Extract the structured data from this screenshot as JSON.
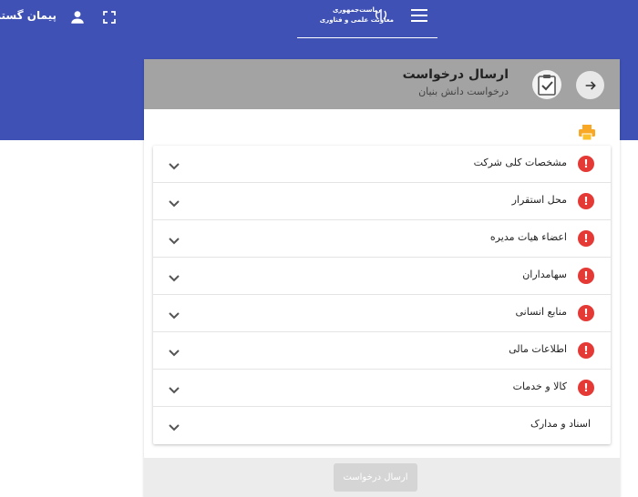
{
  "header": {
    "user_name": "پیمان گستران د",
    "brand_line1": "ریاست‌جمهوری",
    "brand_line2": "معاونت علمی و فناوری",
    "icons": {
      "user": "user-icon",
      "fullscreen": "fullscreen-icon",
      "menu": "menu-icon",
      "emblem": "iran-emblem-icon"
    }
  },
  "card": {
    "title": "ارسال درخواست",
    "subtitle": "درخواست دانش بنیان",
    "print_icon": "printer-icon",
    "print_color": "#f9a825"
  },
  "sections": [
    {
      "label": "مشخصات کلی شرکت",
      "alert": true
    },
    {
      "label": "محل استقرار",
      "alert": true
    },
    {
      "label": "اعضاء هیات مدیره",
      "alert": true
    },
    {
      "label": "سهامداران",
      "alert": true
    },
    {
      "label": "منابع انسانی",
      "alert": true
    },
    {
      "label": "اطلاعات مالی",
      "alert": true
    },
    {
      "label": "کالا و خدمات",
      "alert": true
    },
    {
      "label": "اسناد و مدارک",
      "alert": false
    }
  ],
  "alert_glyph": "!",
  "footer": {
    "submit_label": "ارسال درخواست"
  },
  "colors": {
    "primary": "#3f51b5",
    "alert": "#e53935",
    "header_gray": "#a3a3a3"
  }
}
